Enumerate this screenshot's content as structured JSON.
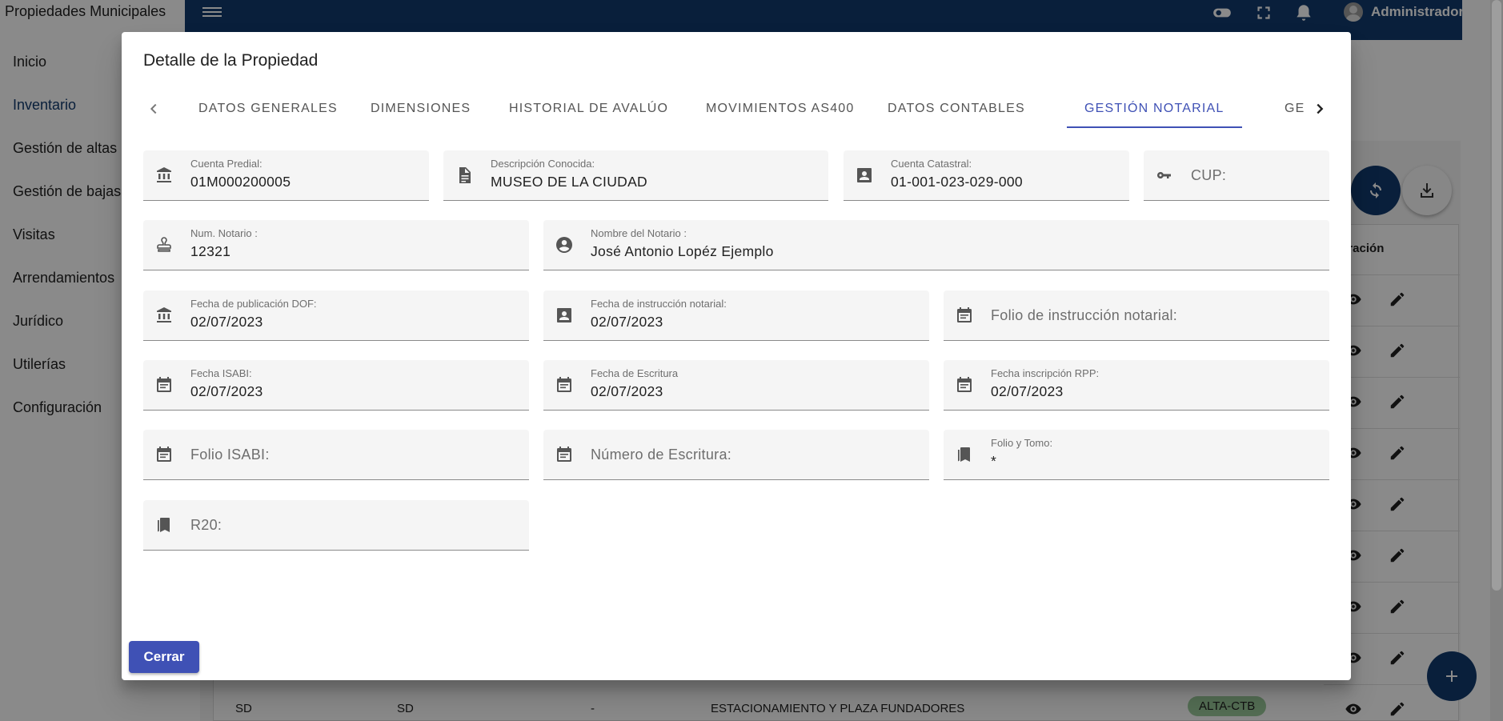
{
  "app": {
    "title": "Propiedades Municipales",
    "user_name": "Administrador"
  },
  "sidebar": {
    "items": [
      {
        "label": "Inicio"
      },
      {
        "label": "Inventario"
      },
      {
        "label": "Gestión de altas"
      },
      {
        "label": "Gestión de bajas"
      },
      {
        "label": "Visitas"
      },
      {
        "label": "Arrendamientos"
      },
      {
        "label": "Jurídico"
      },
      {
        "label": "Utilerías"
      },
      {
        "label": "Configuración"
      }
    ]
  },
  "background_table": {
    "operation_header": "eración",
    "last_row": {
      "col1": "SD",
      "col2": "SD",
      "col3": "-",
      "col4": "ESTACIONAMIENTO Y PLAZA FUNDADORES",
      "status": "ALTA-CTB"
    }
  },
  "dialog": {
    "title": "Detalle de la Propiedad",
    "tabs": [
      {
        "label": "DATOS GENERALES"
      },
      {
        "label": "DIMENSIONES"
      },
      {
        "label": "HISTORIAL DE AVALÚO"
      },
      {
        "label": "MOVIMIENTOS AS400"
      },
      {
        "label": "DATOS CONTABLES"
      },
      {
        "label": "GESTIÓN NOTARIAL"
      },
      {
        "label": "GEOLOC"
      }
    ],
    "active_tab": "GESTIÓN NOTARIAL",
    "fields": {
      "cuenta_predial": {
        "label": "Cuenta Predial:",
        "value": "01M000200005",
        "icon": "bank-icon"
      },
      "descripcion": {
        "label": "Descripción Conocida:",
        "value": "MUSEO DE LA CIUDAD",
        "icon": "document-icon"
      },
      "cuenta_catastral": {
        "label": "Cuenta Catastral:",
        "value": "01-001-023-029-000",
        "icon": "contact-card-icon"
      },
      "cup": {
        "placeholder": "CUP:",
        "icon": "key-icon"
      },
      "num_notario": {
        "label": "Num. Notario :",
        "value": "12321",
        "icon": "stamp-icon"
      },
      "nombre_notario": {
        "label": "Nombre del Notario :",
        "value": "José Antonio Lopéz Ejemplo",
        "icon": "account-circle-icon"
      },
      "fecha_dof": {
        "label": "Fecha de publicación DOF:",
        "value": "02/07/2023",
        "icon": "bank-icon"
      },
      "fecha_instruccion": {
        "label": "Fecha de instrucción notarial:",
        "value": "02/07/2023",
        "icon": "contact-card-icon"
      },
      "folio_instruccion": {
        "placeholder": "Folio de instrucción notarial:",
        "icon": "calendar-icon"
      },
      "fecha_isabi": {
        "label": "Fecha ISABI:",
        "value": "02/07/2023",
        "icon": "calendar-icon"
      },
      "fecha_escritura": {
        "label": "Fecha de Escritura",
        "value": "02/07/2023",
        "icon": "calendar-icon"
      },
      "fecha_rpp": {
        "label": "Fecha inscripción RPP:",
        "value": "02/07/2023",
        "icon": "calendar-icon"
      },
      "folio_isabi": {
        "placeholder": "Folio ISABI:",
        "icon": "calendar-icon"
      },
      "numero_escritura": {
        "placeholder": "Número de Escritura:",
        "icon": "calendar-icon"
      },
      "folio_tomo": {
        "label": "Folio y Tomo:",
        "value": "*",
        "icon": "bookmarks-icon"
      },
      "r20": {
        "placeholder": "R20:",
        "icon": "bookmarks-icon"
      }
    },
    "close_label": "Cerrar"
  },
  "colors": {
    "navbar": "#123a6e",
    "accent": "#3f51b5",
    "field_bg": "#f5f5f5",
    "chip": "#9ccc9c"
  }
}
